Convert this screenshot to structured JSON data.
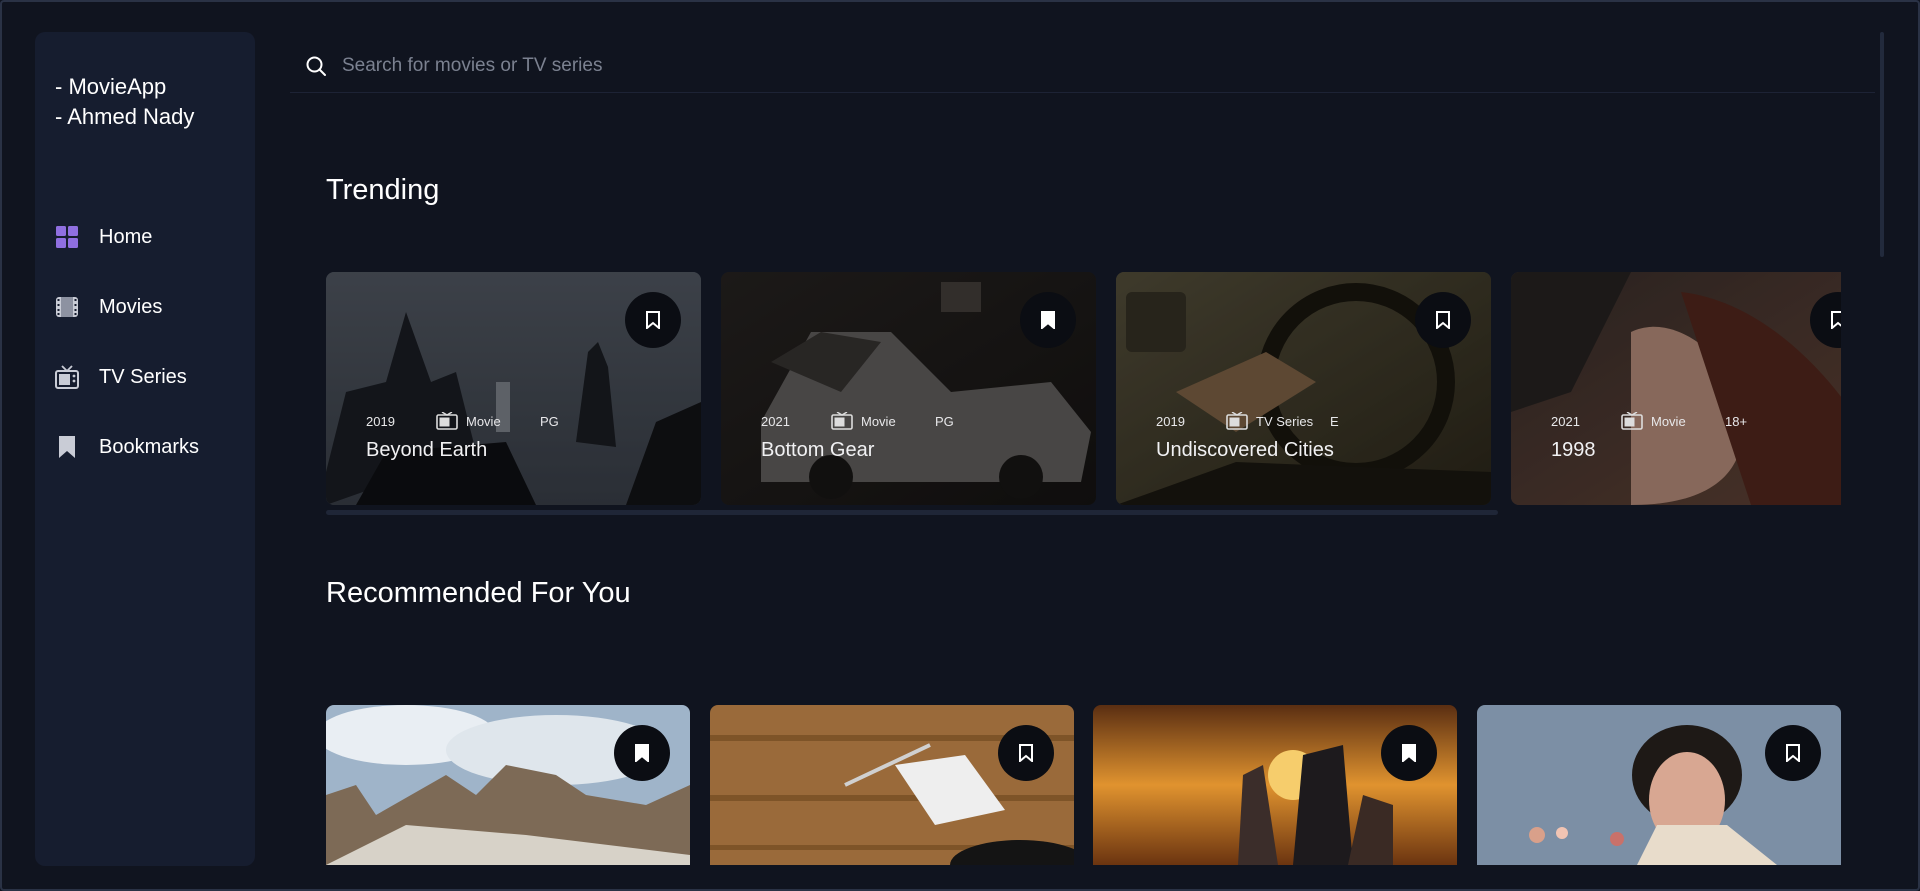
{
  "sidebar": {
    "brand_lines": [
      "- MovieApp",
      "- Ahmed Nady"
    ],
    "items": [
      {
        "label": "Home",
        "icon": "grid-icon",
        "active": true
      },
      {
        "label": "Movies",
        "icon": "film-icon"
      },
      {
        "label": "TV Series",
        "icon": "tv-icon"
      },
      {
        "label": "Bookmarks",
        "icon": "bookmark-icon"
      }
    ]
  },
  "search": {
    "placeholder": "Search for movies or TV series",
    "value": ""
  },
  "trending": {
    "heading": "Trending",
    "items": [
      {
        "year": "2019",
        "category": "Movie",
        "rating": "PG",
        "title": "Beyond Earth"
      },
      {
        "year": "2021",
        "category": "Movie",
        "rating": "PG",
        "title": "Bottom Gear"
      },
      {
        "year": "2019",
        "category": "TV Series",
        "rating": "E",
        "title": "Undiscovered Cities"
      },
      {
        "year": "2021",
        "category": "Movie",
        "rating": "18+",
        "title": "1998"
      }
    ]
  },
  "recommended": {
    "heading": "Recommended For You",
    "items": [
      {
        "image": "mountains"
      },
      {
        "image": "desk-note"
      },
      {
        "image": "sunset-friends"
      },
      {
        "image": "portrait-boy"
      }
    ]
  },
  "colors": {
    "background": "#10141f",
    "sidebar": "#161d2f",
    "accent": "#8f6fe0"
  }
}
